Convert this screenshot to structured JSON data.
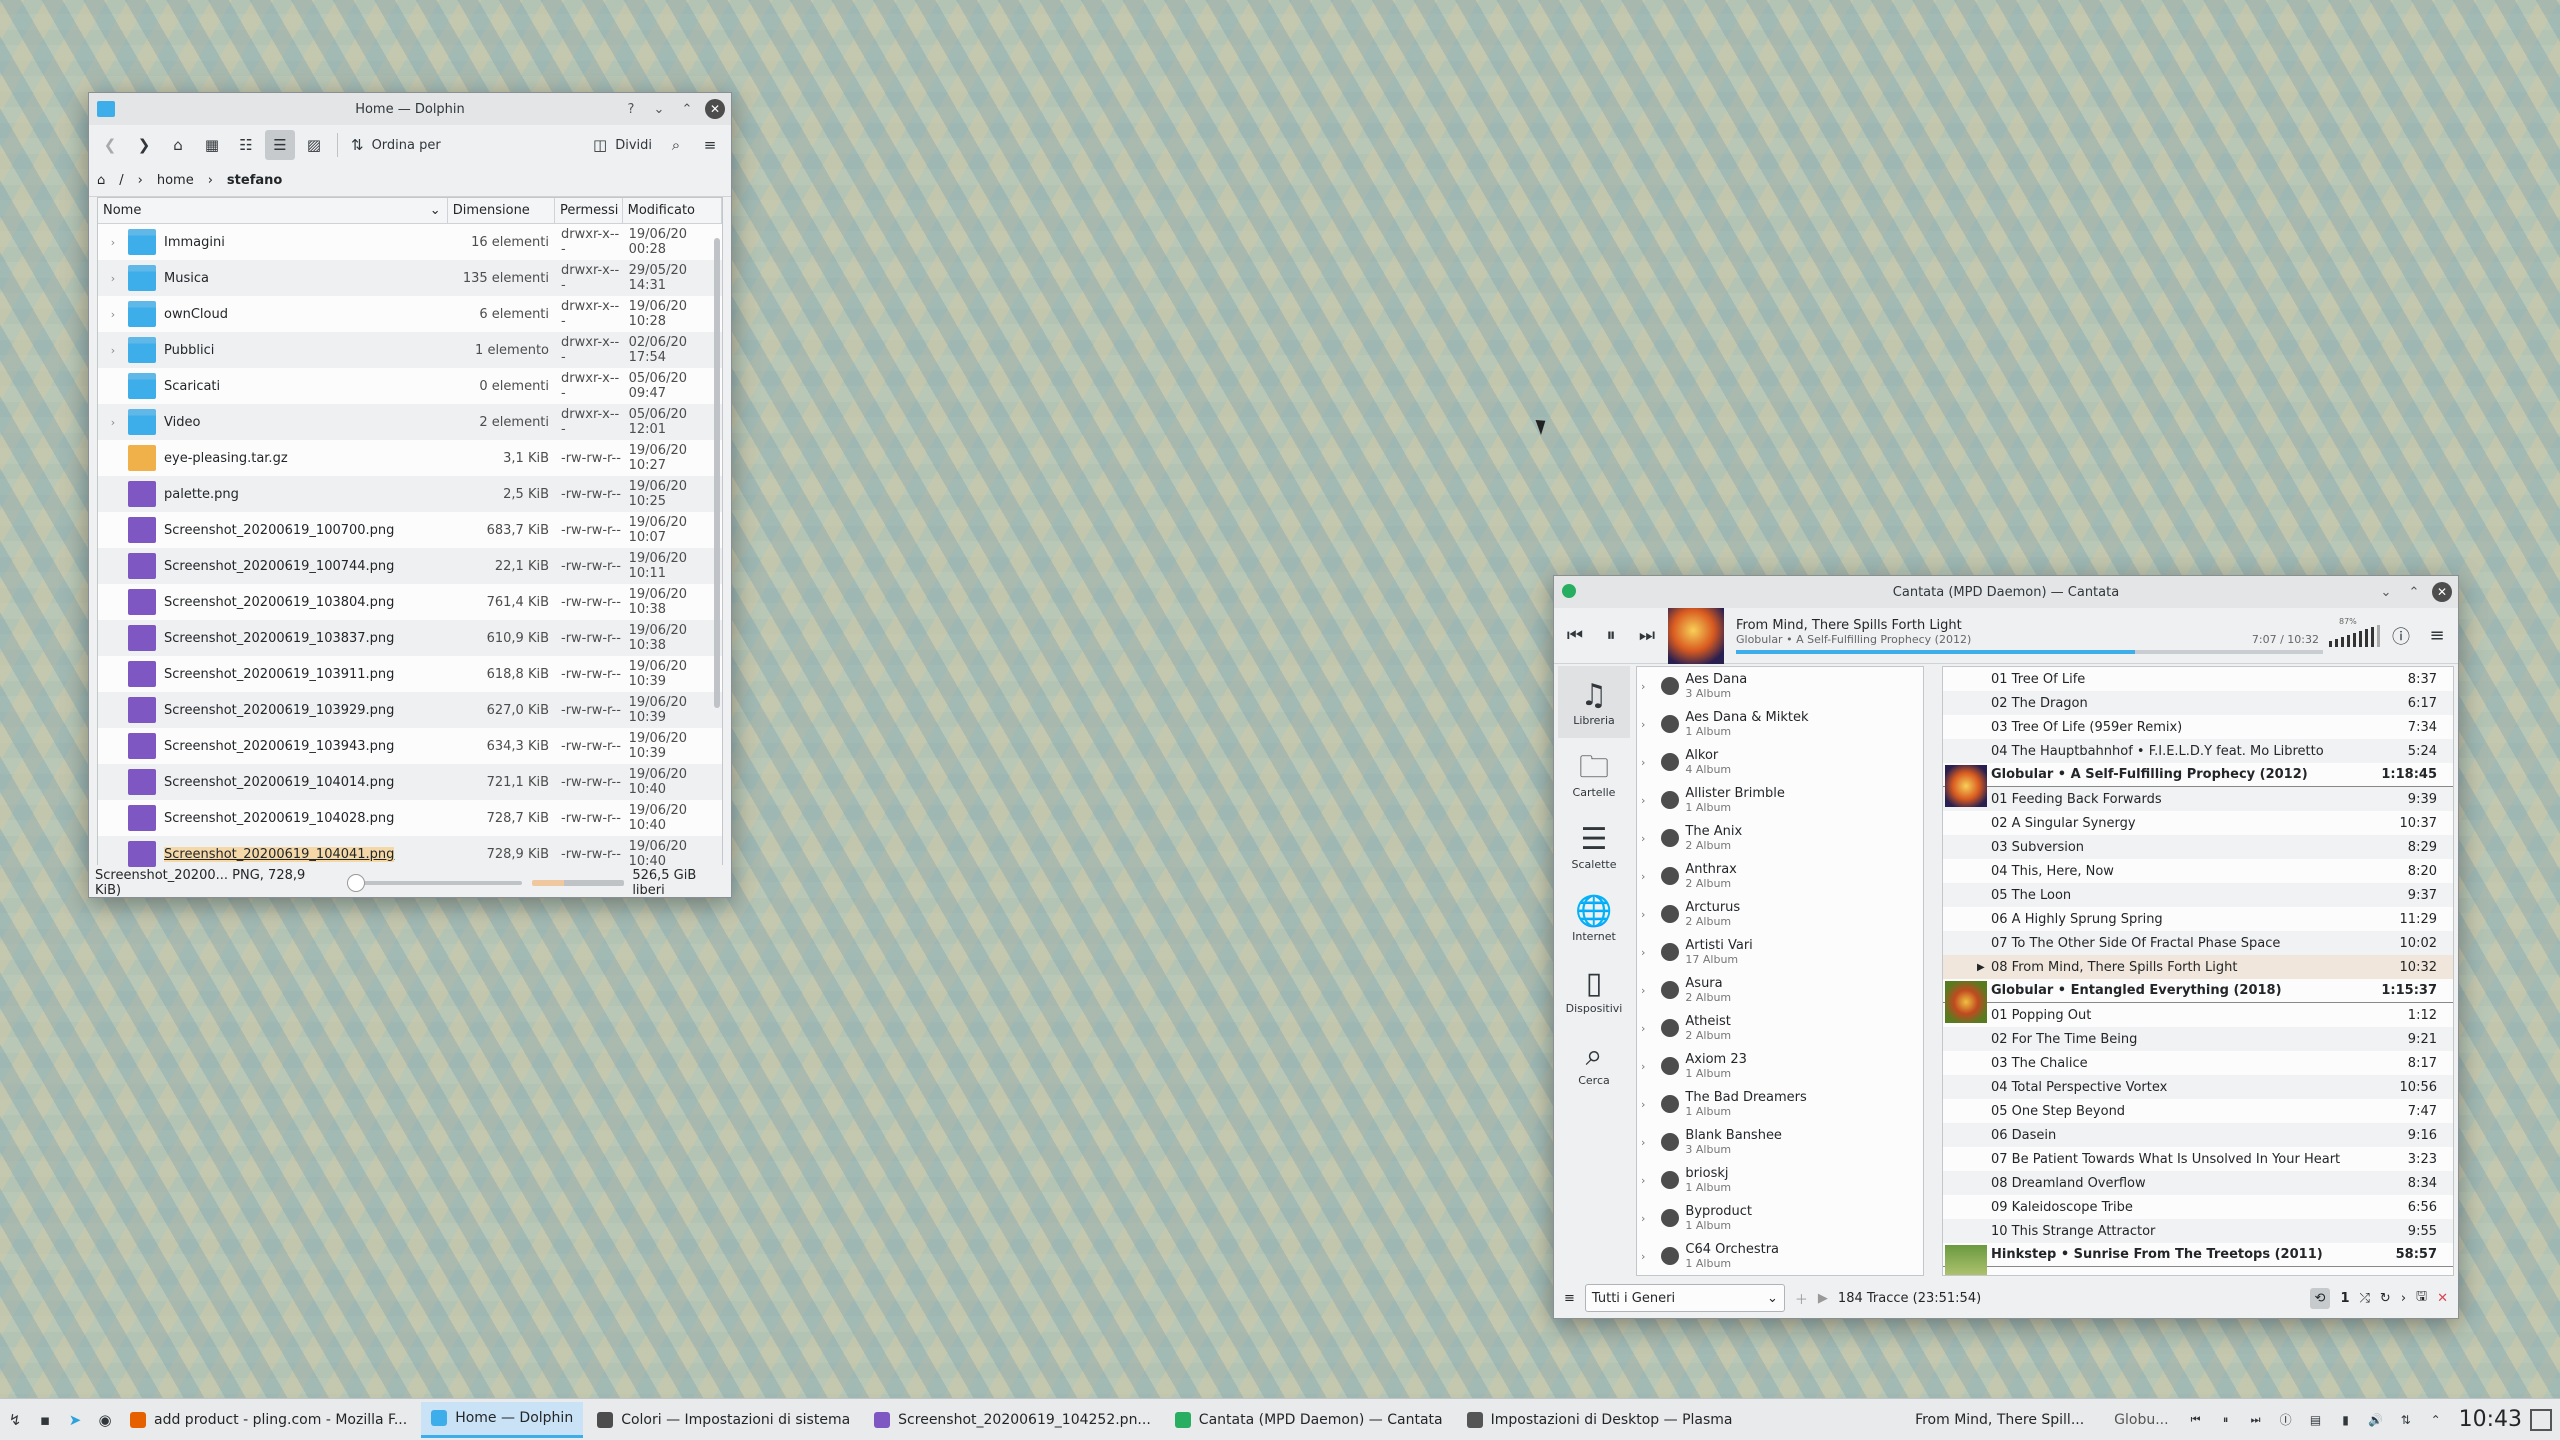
{
  "dolphin": {
    "title": "Home — Dolphin",
    "toolbar": {
      "sort_label": "Ordina per",
      "split_label": "Dividi"
    },
    "breadcrumb": [
      "/",
      "home",
      "stefano"
    ],
    "columns": [
      "Nome",
      "Dimensione",
      "Permessi",
      "Modificato"
    ],
    "rows": [
      {
        "name": "Immagini",
        "size": "16 elementi",
        "perm": "drwxr-x---",
        "mod": "19/06/20 00:28",
        "type": "folder",
        "expandable": true
      },
      {
        "name": "Musica",
        "size": "135 elementi",
        "perm": "drwxr-x---",
        "mod": "29/05/20 14:31",
        "type": "folder",
        "expandable": true
      },
      {
        "name": "ownCloud",
        "size": "6 elementi",
        "perm": "drwxr-x---",
        "mod": "19/06/20 10:28",
        "type": "folder",
        "expandable": true
      },
      {
        "name": "Pubblici",
        "size": "1 elemento",
        "perm": "drwxr-x---",
        "mod": "02/06/20 17:54",
        "type": "folder",
        "expandable": true
      },
      {
        "name": "Scaricati",
        "size": "0 elementi",
        "perm": "drwxr-x---",
        "mod": "05/06/20 09:47",
        "type": "folder",
        "expandable": false
      },
      {
        "name": "Video",
        "size": "2 elementi",
        "perm": "drwxr-x---",
        "mod": "05/06/20 12:01",
        "type": "folder",
        "expandable": true
      },
      {
        "name": "eye-pleasing.tar.gz",
        "size": "3,1 KiB",
        "perm": "-rw-rw-r--",
        "mod": "19/06/20 10:27",
        "type": "tgz",
        "expandable": false
      },
      {
        "name": "palette.png",
        "size": "2,5 KiB",
        "perm": "-rw-rw-r--",
        "mod": "19/06/20 10:25",
        "type": "png",
        "expandable": false
      },
      {
        "name": "Screenshot_20200619_100700.png",
        "size": "683,7 KiB",
        "perm": "-rw-rw-r--",
        "mod": "19/06/20 10:07",
        "type": "png",
        "expandable": false
      },
      {
        "name": "Screenshot_20200619_100744.png",
        "size": "22,1 KiB",
        "perm": "-rw-rw-r--",
        "mod": "19/06/20 10:11",
        "type": "png",
        "expandable": false
      },
      {
        "name": "Screenshot_20200619_103804.png",
        "size": "761,4 KiB",
        "perm": "-rw-rw-r--",
        "mod": "19/06/20 10:38",
        "type": "png",
        "expandable": false
      },
      {
        "name": "Screenshot_20200619_103837.png",
        "size": "610,9 KiB",
        "perm": "-rw-rw-r--",
        "mod": "19/06/20 10:38",
        "type": "png",
        "expandable": false
      },
      {
        "name": "Screenshot_20200619_103911.png",
        "size": "618,8 KiB",
        "perm": "-rw-rw-r--",
        "mod": "19/06/20 10:39",
        "type": "png",
        "expandable": false
      },
      {
        "name": "Screenshot_20200619_103929.png",
        "size": "627,0 KiB",
        "perm": "-rw-rw-r--",
        "mod": "19/06/20 10:39",
        "type": "png",
        "expandable": false
      },
      {
        "name": "Screenshot_20200619_103943.png",
        "size": "634,3 KiB",
        "perm": "-rw-rw-r--",
        "mod": "19/06/20 10:39",
        "type": "png",
        "expandable": false
      },
      {
        "name": "Screenshot_20200619_104014.png",
        "size": "721,1 KiB",
        "perm": "-rw-rw-r--",
        "mod": "19/06/20 10:40",
        "type": "png",
        "expandable": false
      },
      {
        "name": "Screenshot_20200619_104028.png",
        "size": "728,7 KiB",
        "perm": "-rw-rw-r--",
        "mod": "19/06/20 10:40",
        "type": "png",
        "expandable": false
      },
      {
        "name": "Screenshot_20200619_104041.png",
        "size": "728,9 KiB",
        "perm": "-rw-rw-r--",
        "mod": "19/06/20 10:40",
        "type": "png",
        "expandable": false,
        "selected": true
      }
    ],
    "status_text": "Screenshot_20200... PNG, 728,9 KiB)",
    "free_space": "526,5 GiB liberi"
  },
  "cantata": {
    "title": "Cantata (MPD Daemon) — Cantata",
    "now_playing": {
      "title": "From Mind, There Spills Forth Light",
      "subtitle": "Globular • A Self-Fulfilling Prophecy (2012)",
      "time": "7:07 / 10:32",
      "volume": "87%"
    },
    "nav": [
      "Libreria",
      "Cartelle",
      "Scalette",
      "Internet",
      "Dispositivi",
      "Cerca"
    ],
    "artists": [
      {
        "name": "Aes Dana",
        "sub": "3 Album"
      },
      {
        "name": "Aes Dana & Miktek",
        "sub": "1 Album"
      },
      {
        "name": "Alkor",
        "sub": "4 Album"
      },
      {
        "name": "Allister Brimble",
        "sub": "1 Album"
      },
      {
        "name": "The Anix",
        "sub": "2 Album"
      },
      {
        "name": "Anthrax",
        "sub": "2 Album"
      },
      {
        "name": "Arcturus",
        "sub": "2 Album"
      },
      {
        "name": "Artisti Vari",
        "sub": "17 Album"
      },
      {
        "name": "Asura",
        "sub": "2 Album"
      },
      {
        "name": "Atheist",
        "sub": "2 Album"
      },
      {
        "name": "Axiom 23",
        "sub": "1 Album"
      },
      {
        "name": "The Bad Dreamers",
        "sub": "1 Album"
      },
      {
        "name": "Blank Banshee",
        "sub": "3 Album"
      },
      {
        "name": "brioskj",
        "sub": "1 Album"
      },
      {
        "name": "Byproduct",
        "sub": "1 Album"
      },
      {
        "name": "C64 Orchestra",
        "sub": "1 Album"
      }
    ],
    "playlist": [
      {
        "kind": "track",
        "title": "01 Tree Of Life",
        "dur": "8:37"
      },
      {
        "kind": "track",
        "title": "02 The Dragon",
        "dur": "6:17"
      },
      {
        "kind": "track",
        "title": "03 Tree Of Life (959er Remix)",
        "dur": "7:34"
      },
      {
        "kind": "track",
        "title": "04 The Hauptbahnhof • F.I.E.L.D.Y feat. Mo Libretto",
        "dur": "5:24"
      },
      {
        "kind": "album",
        "title": "Globular • A Self-Fulfilling Prophecy (2012)",
        "dur": "1:18:45"
      },
      {
        "kind": "track",
        "title": "01 Feeding Back Forwards",
        "dur": "9:39"
      },
      {
        "kind": "track",
        "title": "02 A Singular Synergy",
        "dur": "10:37"
      },
      {
        "kind": "track",
        "title": "03 Subversion",
        "dur": "8:29"
      },
      {
        "kind": "track",
        "title": "04 This, Here, Now",
        "dur": "8:20"
      },
      {
        "kind": "track",
        "title": "05 The Loon",
        "dur": "9:37"
      },
      {
        "kind": "track",
        "title": "06 A Highly Sprung Spring",
        "dur": "11:29"
      },
      {
        "kind": "track",
        "title": "07 To The Other Side Of Fractal Phase Space",
        "dur": "10:02"
      },
      {
        "kind": "playing",
        "title": "08 From Mind, There Spills Forth Light",
        "dur": "10:32"
      },
      {
        "kind": "album",
        "title": "Globular • Entangled Everything (2018)",
        "dur": "1:15:37"
      },
      {
        "kind": "track",
        "title": "01 Popping Out",
        "dur": "1:12"
      },
      {
        "kind": "track",
        "title": "02 For The Time Being",
        "dur": "9:21"
      },
      {
        "kind": "track",
        "title": "03 The Chalice",
        "dur": "8:17"
      },
      {
        "kind": "track",
        "title": "04 Total Perspective Vortex",
        "dur": "10:56"
      },
      {
        "kind": "track",
        "title": "05 One Step Beyond",
        "dur": "7:47"
      },
      {
        "kind": "track",
        "title": "06 Dasein",
        "dur": "9:16"
      },
      {
        "kind": "track",
        "title": "07 Be Patient Towards What Is Unsolved In Your Heart",
        "dur": "3:23"
      },
      {
        "kind": "track",
        "title": "08 Dreamland Overflow",
        "dur": "8:34"
      },
      {
        "kind": "track",
        "title": "09 Kaleidoscope Tribe",
        "dur": "6:56"
      },
      {
        "kind": "track",
        "title": "10 This Strange Attractor",
        "dur": "9:55"
      },
      {
        "kind": "album",
        "title": "Hinkstep • Sunrise From The Treetops (2011)",
        "dur": "58:57"
      }
    ],
    "genre_filter": "Tutti i Generi",
    "track_count": "184 Tracce (23:51:54)",
    "repeat_count": "1"
  },
  "taskbar": {
    "tasks": [
      {
        "label": "add product - pling.com - Mozilla F...",
        "icon": "firefox-icon",
        "color": "#e66000"
      },
      {
        "label": "Home — Dolphin",
        "icon": "dolphin-icon",
        "color": "#3daee9",
        "active": true
      },
      {
        "label": "Colori — Impostazioni di sistema",
        "icon": "settings-icon",
        "color": "#4d4d4d"
      },
      {
        "label": "Screenshot_20200619_104252.pn...",
        "icon": "image-icon",
        "color": "#7e57c2"
      },
      {
        "label": "Cantata (MPD Daemon) — Cantata",
        "icon": "cantata-icon",
        "color": "#27ae60"
      },
      {
        "label": "Impostazioni di Desktop — Plasma",
        "icon": "desktop-icon",
        "color": "#555"
      }
    ],
    "media_title": "From Mind, There Spill...",
    "media_artist": "Globu...",
    "clock": "10:43"
  }
}
